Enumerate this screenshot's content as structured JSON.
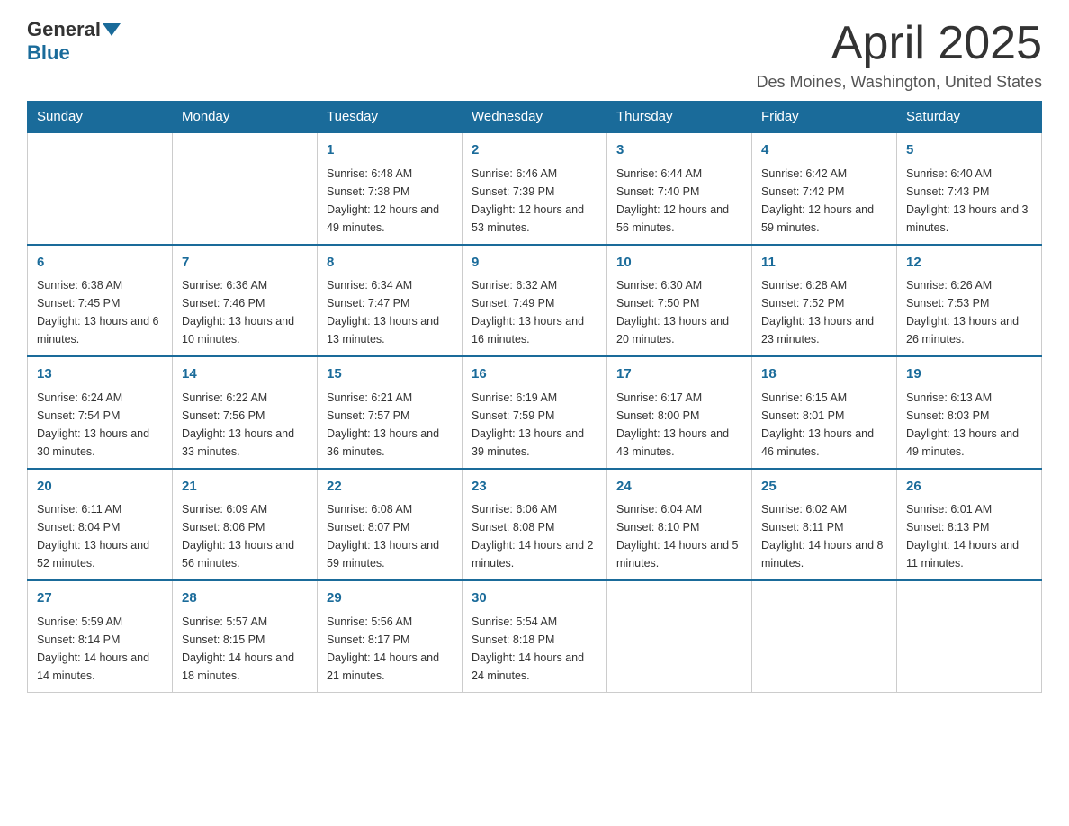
{
  "header": {
    "logo_general": "General",
    "logo_blue": "Blue",
    "month_title": "April 2025",
    "location": "Des Moines, Washington, United States"
  },
  "days_of_week": [
    "Sunday",
    "Monday",
    "Tuesday",
    "Wednesday",
    "Thursday",
    "Friday",
    "Saturday"
  ],
  "weeks": [
    [
      {
        "day": "",
        "info": ""
      },
      {
        "day": "",
        "info": ""
      },
      {
        "day": "1",
        "info": "Sunrise: 6:48 AM\nSunset: 7:38 PM\nDaylight: 12 hours\nand 49 minutes."
      },
      {
        "day": "2",
        "info": "Sunrise: 6:46 AM\nSunset: 7:39 PM\nDaylight: 12 hours\nand 53 minutes."
      },
      {
        "day": "3",
        "info": "Sunrise: 6:44 AM\nSunset: 7:40 PM\nDaylight: 12 hours\nand 56 minutes."
      },
      {
        "day": "4",
        "info": "Sunrise: 6:42 AM\nSunset: 7:42 PM\nDaylight: 12 hours\nand 59 minutes."
      },
      {
        "day": "5",
        "info": "Sunrise: 6:40 AM\nSunset: 7:43 PM\nDaylight: 13 hours\nand 3 minutes."
      }
    ],
    [
      {
        "day": "6",
        "info": "Sunrise: 6:38 AM\nSunset: 7:45 PM\nDaylight: 13 hours\nand 6 minutes."
      },
      {
        "day": "7",
        "info": "Sunrise: 6:36 AM\nSunset: 7:46 PM\nDaylight: 13 hours\nand 10 minutes."
      },
      {
        "day": "8",
        "info": "Sunrise: 6:34 AM\nSunset: 7:47 PM\nDaylight: 13 hours\nand 13 minutes."
      },
      {
        "day": "9",
        "info": "Sunrise: 6:32 AM\nSunset: 7:49 PM\nDaylight: 13 hours\nand 16 minutes."
      },
      {
        "day": "10",
        "info": "Sunrise: 6:30 AM\nSunset: 7:50 PM\nDaylight: 13 hours\nand 20 minutes."
      },
      {
        "day": "11",
        "info": "Sunrise: 6:28 AM\nSunset: 7:52 PM\nDaylight: 13 hours\nand 23 minutes."
      },
      {
        "day": "12",
        "info": "Sunrise: 6:26 AM\nSunset: 7:53 PM\nDaylight: 13 hours\nand 26 minutes."
      }
    ],
    [
      {
        "day": "13",
        "info": "Sunrise: 6:24 AM\nSunset: 7:54 PM\nDaylight: 13 hours\nand 30 minutes."
      },
      {
        "day": "14",
        "info": "Sunrise: 6:22 AM\nSunset: 7:56 PM\nDaylight: 13 hours\nand 33 minutes."
      },
      {
        "day": "15",
        "info": "Sunrise: 6:21 AM\nSunset: 7:57 PM\nDaylight: 13 hours\nand 36 minutes."
      },
      {
        "day": "16",
        "info": "Sunrise: 6:19 AM\nSunset: 7:59 PM\nDaylight: 13 hours\nand 39 minutes."
      },
      {
        "day": "17",
        "info": "Sunrise: 6:17 AM\nSunset: 8:00 PM\nDaylight: 13 hours\nand 43 minutes."
      },
      {
        "day": "18",
        "info": "Sunrise: 6:15 AM\nSunset: 8:01 PM\nDaylight: 13 hours\nand 46 minutes."
      },
      {
        "day": "19",
        "info": "Sunrise: 6:13 AM\nSunset: 8:03 PM\nDaylight: 13 hours\nand 49 minutes."
      }
    ],
    [
      {
        "day": "20",
        "info": "Sunrise: 6:11 AM\nSunset: 8:04 PM\nDaylight: 13 hours\nand 52 minutes."
      },
      {
        "day": "21",
        "info": "Sunrise: 6:09 AM\nSunset: 8:06 PM\nDaylight: 13 hours\nand 56 minutes."
      },
      {
        "day": "22",
        "info": "Sunrise: 6:08 AM\nSunset: 8:07 PM\nDaylight: 13 hours\nand 59 minutes."
      },
      {
        "day": "23",
        "info": "Sunrise: 6:06 AM\nSunset: 8:08 PM\nDaylight: 14 hours\nand 2 minutes."
      },
      {
        "day": "24",
        "info": "Sunrise: 6:04 AM\nSunset: 8:10 PM\nDaylight: 14 hours\nand 5 minutes."
      },
      {
        "day": "25",
        "info": "Sunrise: 6:02 AM\nSunset: 8:11 PM\nDaylight: 14 hours\nand 8 minutes."
      },
      {
        "day": "26",
        "info": "Sunrise: 6:01 AM\nSunset: 8:13 PM\nDaylight: 14 hours\nand 11 minutes."
      }
    ],
    [
      {
        "day": "27",
        "info": "Sunrise: 5:59 AM\nSunset: 8:14 PM\nDaylight: 14 hours\nand 14 minutes."
      },
      {
        "day": "28",
        "info": "Sunrise: 5:57 AM\nSunset: 8:15 PM\nDaylight: 14 hours\nand 18 minutes."
      },
      {
        "day": "29",
        "info": "Sunrise: 5:56 AM\nSunset: 8:17 PM\nDaylight: 14 hours\nand 21 minutes."
      },
      {
        "day": "30",
        "info": "Sunrise: 5:54 AM\nSunset: 8:18 PM\nDaylight: 14 hours\nand 24 minutes."
      },
      {
        "day": "",
        "info": ""
      },
      {
        "day": "",
        "info": ""
      },
      {
        "day": "",
        "info": ""
      }
    ]
  ]
}
